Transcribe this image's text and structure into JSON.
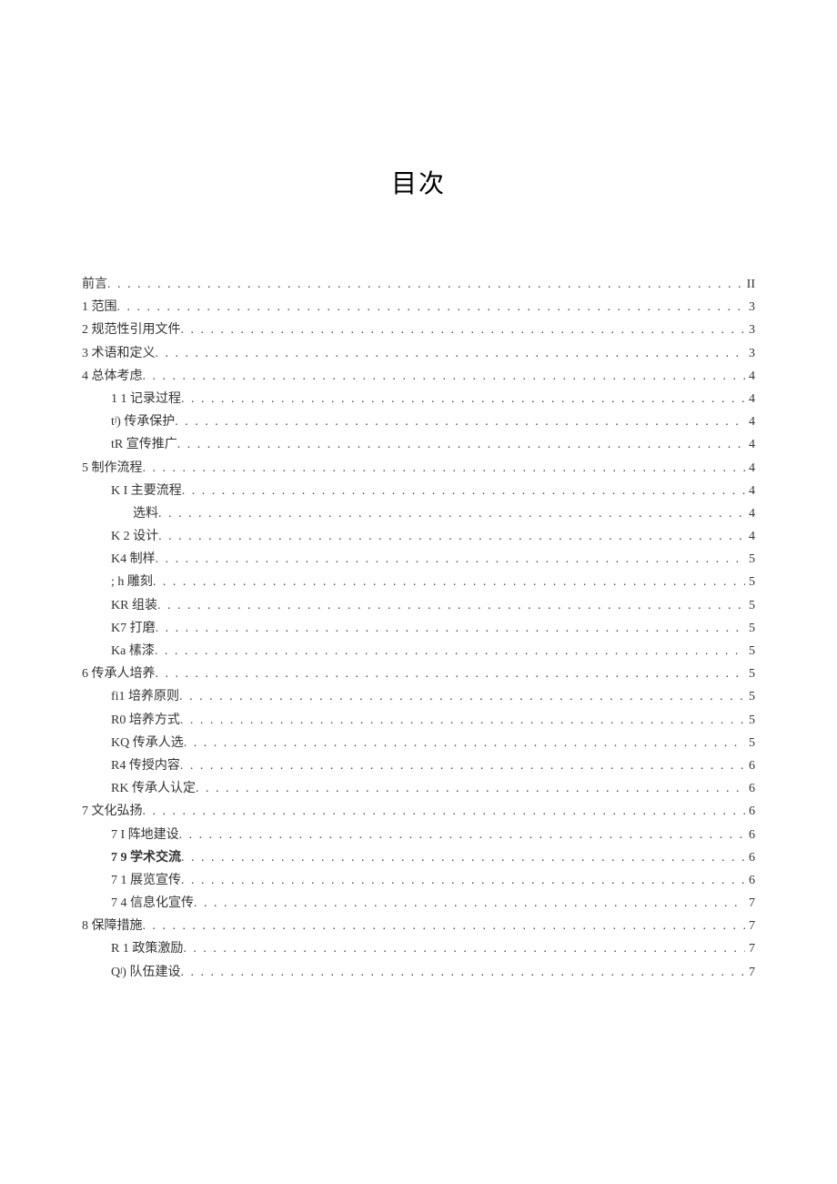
{
  "title": "目次",
  "toc": [
    {
      "indent": 0,
      "label": "前言",
      "page": "II",
      "bold": false
    },
    {
      "indent": 0,
      "label": "1 范围",
      "page": "3",
      "bold": false
    },
    {
      "indent": 0,
      "label": "2 规范性引用文件",
      "page": "3",
      "bold": false
    },
    {
      "indent": 0,
      "label": "3  术语和定义",
      "page": "3",
      "bold": false
    },
    {
      "indent": 0,
      "label": "4  总体考虑",
      "page": "4",
      "bold": false
    },
    {
      "indent": 1,
      "label": "1 1 记录过程",
      "page": "4",
      "bold": false
    },
    {
      "indent": 1,
      "label": "tʲ) 传承保护",
      "page": "4",
      "bold": false
    },
    {
      "indent": 1,
      "label": "tR 宣传推广",
      "page": "4",
      "bold": false
    },
    {
      "indent": 0,
      "label": "5  制作流程",
      "page": "4",
      "bold": false
    },
    {
      "indent": 1,
      "label": "K  I 主要流程",
      "page": "4",
      "bold": false
    },
    {
      "indent": 2,
      "label": "选料",
      "page": "4",
      "bold": false
    },
    {
      "indent": 1,
      "label": "K  2 设计",
      "page": "4",
      "bold": false
    },
    {
      "indent": 1,
      "label": "K4 制样",
      "page": "5",
      "bold": false
    },
    {
      "indent": 1,
      "label": "; h 雕刻",
      "page": "5",
      "bold": false
    },
    {
      "indent": 1,
      "label": "KR 组装",
      "page": "5",
      "bold": false
    },
    {
      "indent": 1,
      "label": "K7 打磨",
      "page": "5",
      "bold": false
    },
    {
      "indent": 1,
      "label": "Ka 榡漆",
      "page": "5",
      "bold": false
    },
    {
      "indent": 0,
      "label": "6  传承人培养",
      "page": "5",
      "bold": false
    },
    {
      "indent": 1,
      "label": "fi1 培养原则",
      "page": "5",
      "bold": false
    },
    {
      "indent": 1,
      "label": "R0 培养方式",
      "page": "5",
      "bold": false
    },
    {
      "indent": 1,
      "label": "KQ 传承人选",
      "page": "5",
      "bold": false
    },
    {
      "indent": 1,
      "label": "R4 传授内容",
      "page": "6",
      "bold": false
    },
    {
      "indent": 1,
      "label": "RK 传承人认定",
      "page": "6",
      "bold": false
    },
    {
      "indent": 0,
      "label": "7 文化弘扬",
      "page": "6",
      "bold": false
    },
    {
      "indent": 1,
      "label": "7  I 阵地建设",
      "page": "6",
      "bold": false
    },
    {
      "indent": 1,
      "label": "7  9 学术交流",
      "page": "6",
      "bold": true
    },
    {
      "indent": 1,
      "label": "7  1 展览宣传",
      "page": "6",
      "bold": false
    },
    {
      "indent": 1,
      "label": "7  4 信息化宣传",
      "page": "7",
      "bold": false
    },
    {
      "indent": 0,
      "label": "8 保障措施",
      "page": "7",
      "bold": false
    },
    {
      "indent": 1,
      "label": "R  1 政策激励",
      "page": "7",
      "bold": false
    },
    {
      "indent": 1,
      "label": "Qʲ) 队伍建设",
      "page": "7",
      "bold": false
    }
  ]
}
